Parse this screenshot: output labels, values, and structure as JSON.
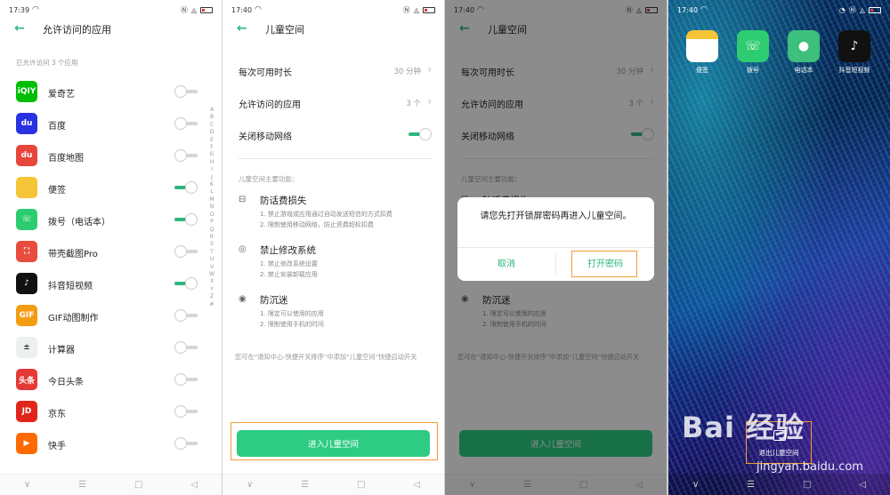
{
  "panel1": {
    "status_time": "17:39",
    "title": "允许访问的应用",
    "subtitle": "已允许访问 3 个应用",
    "alpha_index": [
      "A",
      "B",
      "C",
      "D",
      "E",
      "F",
      "G",
      "H",
      "I",
      "J",
      "K",
      "L",
      "M",
      "N",
      "O",
      "P",
      "Q",
      "R",
      "S",
      "T",
      "U",
      "V",
      "W",
      "X",
      "Y",
      "Z",
      "#"
    ],
    "apps": [
      {
        "label": "爱奇艺",
        "icon_text": "iQIY",
        "color": "#00be06",
        "on": false
      },
      {
        "label": "百度",
        "icon_text": "du",
        "color": "#2932e1",
        "on": false
      },
      {
        "label": "百度地图",
        "icon_text": "du",
        "color": "#e8453c",
        "on": false
      },
      {
        "label": "便签",
        "icon_text": "",
        "color": "#f6c437",
        "on": true
      },
      {
        "label": "拨号（电话本）",
        "icon_text": "☏",
        "color": "#2ecc71",
        "on": true
      },
      {
        "label": "带壳截图Pro",
        "icon_text": "⛶",
        "color": "#e74c3c",
        "on": false
      },
      {
        "label": "抖音短视频",
        "icon_text": "♪",
        "color": "#111111",
        "on": true
      },
      {
        "label": "GIF动图制作",
        "icon_text": "GIF",
        "color": "#f39c12",
        "on": false
      },
      {
        "label": "计算器",
        "icon_text": "±",
        "color": "#ecf0f1",
        "on": false
      },
      {
        "label": "今日头条",
        "icon_text": "头条",
        "color": "#e53935",
        "on": false
      },
      {
        "label": "京东",
        "icon_text": "JD",
        "color": "#e1251b",
        "on": false
      },
      {
        "label": "快手",
        "icon_text": "▶",
        "color": "#ff6a00",
        "on": false
      }
    ]
  },
  "panel2": {
    "status_time": "17:40",
    "title": "儿童空间",
    "settings": [
      {
        "label": "每次可用时长",
        "value": "30 分钟",
        "type": "link"
      },
      {
        "label": "允许访问的应用",
        "value": "3 个",
        "type": "link"
      },
      {
        "label": "关闭移动网络",
        "value": "",
        "type": "toggle"
      }
    ],
    "features_heading": "儿童空间主要功能：",
    "features": [
      {
        "icon": "message-icon",
        "glyph": "⊟",
        "title": "防话费损失",
        "d1": "1. 禁止游戏或应用通过自动发送短信的方式扣费",
        "d2": "2. 限制使用移动网络，防止资费超标扣费"
      },
      {
        "icon": "settings-icon",
        "glyph": "◎",
        "title": "禁止修改系统",
        "d1": "1. 禁止修改系统设置",
        "d2": "2. 禁止安装卸载应用"
      },
      {
        "icon": "eye-icon",
        "glyph": "◉",
        "title": "防沉迷",
        "d1": "1. 限定可以使用的应用",
        "d2": "2. 限制使用手机的时间"
      }
    ],
    "note": "您可在“通知中心-快捷开关排序”中添加“儿童空间”快捷启动开关",
    "enter_button": "进入儿童空间"
  },
  "panel3": {
    "status_time": "17:40",
    "dialog_message": "请您先打开锁屏密码再进入儿童空间。",
    "cancel": "取消",
    "confirm": "打开密码"
  },
  "panel4": {
    "status_time": "17:40",
    "apps": [
      {
        "label": "便签",
        "glyph": "",
        "color": "#f6c437"
      },
      {
        "label": "拨号",
        "glyph": "☏",
        "color": "#2ecc71"
      },
      {
        "label": "电话本",
        "glyph": "●",
        "color": "#3dbf7d"
      },
      {
        "label": "抖音短视频",
        "glyph": "♪",
        "color": "#111111"
      }
    ],
    "exit_label": "退出儿童空间",
    "watermark": "Bai 经验",
    "watermark_url": "jingyan.baidu.com"
  },
  "colors": {
    "accent": "#2cb67d",
    "highlight": "#f39c33",
    "button": "#2dcc82"
  }
}
